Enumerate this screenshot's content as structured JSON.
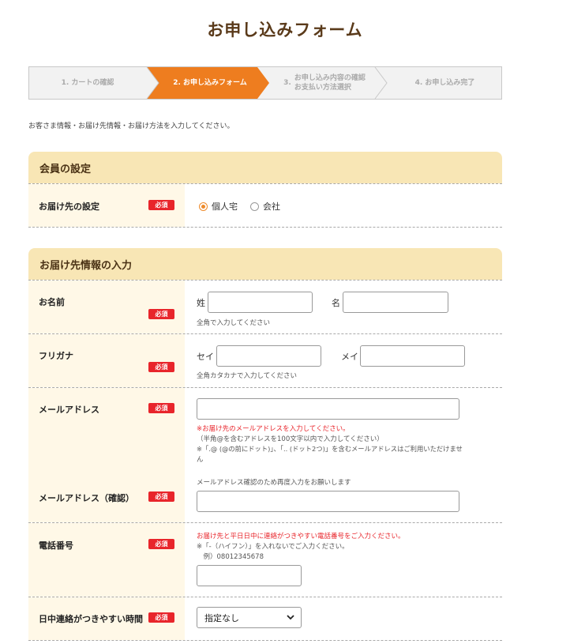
{
  "page": {
    "title": "お申し込みフォーム"
  },
  "steps": [
    {
      "label": "1. カートの確認"
    },
    {
      "label": "2. お申し込みフォーム"
    },
    {
      "label_line1": "3.",
      "label_line2a": "お申し込み内容の確認",
      "label_line2b": "お支払い方法選択"
    },
    {
      "label": "4. お申し込み完了"
    }
  ],
  "intro": "お客さま情報・お届け先情報・お届け方法を入力してください。",
  "required_badge": "必須",
  "member_section": {
    "title": "会員の設定",
    "delivery_setting_label": "お届け先の設定",
    "options": [
      {
        "label": "個人宅",
        "checked": true
      },
      {
        "label": "会社",
        "checked": false
      }
    ]
  },
  "delivery_section": {
    "title": "お届け先情報の入力",
    "name": {
      "label": "お名前",
      "last_prefix": "姓",
      "first_prefix": "名",
      "note": "全角で入力してください",
      "last_value": "",
      "first_value": ""
    },
    "kana": {
      "label": "フリガナ",
      "last_prefix": "セイ",
      "first_prefix": "メイ",
      "note": "全角カタカナで入力してください",
      "last_value": "",
      "first_value": ""
    },
    "email": {
      "label": "メールアドレス",
      "value": "",
      "note_red": "※お届け先のメールアドレスを入力してください。",
      "note_1": "（半角@を含むアドレスを100文字以内で入力してください）",
      "note_2": "※「.@ (@の前にドット)」、「.. (ドット2つ)」を含むメールアドレスはご利用いただけませ",
      "note_2b": "ん"
    },
    "email_confirm": {
      "label": "メールアドレス（確認）",
      "note": "メールアドレス確認のため再度入力をお願いします",
      "value": ""
    },
    "phone": {
      "label": "電話番号",
      "note_red": "お届け先と平日日中に連絡がつきやすい電話番号をご入力ください。",
      "note_1": "※「-（ハイフン）」を入れないでご入力ください。",
      "note_2": "　例）08012345678",
      "value": ""
    },
    "contact_time": {
      "label": "日中連絡がつきやすい時間",
      "selected": "指定なし"
    }
  },
  "colors": {
    "accent": "#ee7d1f",
    "section_bg": "#f8e6b5",
    "label_bg": "#fff8e7",
    "required": "#e8252b"
  }
}
